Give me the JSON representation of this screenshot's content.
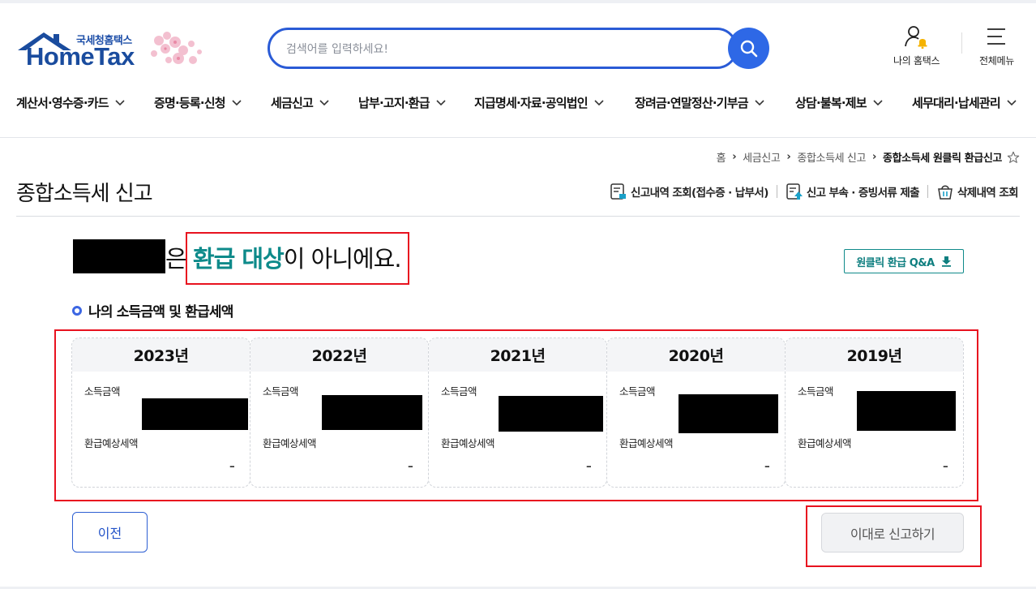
{
  "logo": {
    "small": "국세청홈택스",
    "big": "HomeTax"
  },
  "search": {
    "placeholder": "검색어를 입력하세요!"
  },
  "utilities": {
    "my_hometax": "나의 홈택스",
    "all_menu": "전체메뉴"
  },
  "nav": [
    {
      "label": "계산서·영수증·카드"
    },
    {
      "label": "증명·등록·신청"
    },
    {
      "label": "세금신고"
    },
    {
      "label": "납부·고지·환급"
    },
    {
      "label": "지급명세·자료·공익법인"
    },
    {
      "label": "장려금·연말정산·기부금"
    },
    {
      "label": "상담·불복·제보"
    },
    {
      "label": "세무대리·납세관리"
    }
  ],
  "breadcrumb": {
    "home": "홈",
    "level1": "세금신고",
    "level2": "종합소득세 신고",
    "current": "종합소득세 원클릭 환급신고"
  },
  "page": {
    "title": "종합소득세 신고"
  },
  "actions": {
    "history": "신고내역 조회(접수증 · 납부서)",
    "attach": "신고 부속 · 증빙서류 제출",
    "deleted": "삭제내역 조회"
  },
  "result": {
    "particle": "은 ",
    "highlight": "환급 대상",
    "rest": "이 아니에요."
  },
  "qa_button": "원클릭 환급 Q&A",
  "section_title": "나의 소득금액 및 환급세액",
  "years": [
    {
      "year": "2023년",
      "income_label": "소득금액",
      "refund_label": "환급예상세액",
      "refund_value": "-"
    },
    {
      "year": "2022년",
      "income_label": "소득금액",
      "refund_label": "환급예상세액",
      "refund_value": "-"
    },
    {
      "year": "2021년",
      "income_label": "소득금액",
      "refund_label": "환급예상세액",
      "refund_value": "-"
    },
    {
      "year": "2020년",
      "income_label": "소득금액",
      "refund_label": "환급예상세액",
      "refund_value": "-"
    },
    {
      "year": "2019년",
      "income_label": "소득금액",
      "refund_label": "환급예상세액",
      "refund_value": "-"
    }
  ],
  "buttons": {
    "prev": "이전",
    "submit": "이대로 신고하기"
  },
  "colors": {
    "brand_blue": "#2e68e6",
    "highlight_teal": "#0d8a8a",
    "annotation_red": "#e8121f"
  }
}
